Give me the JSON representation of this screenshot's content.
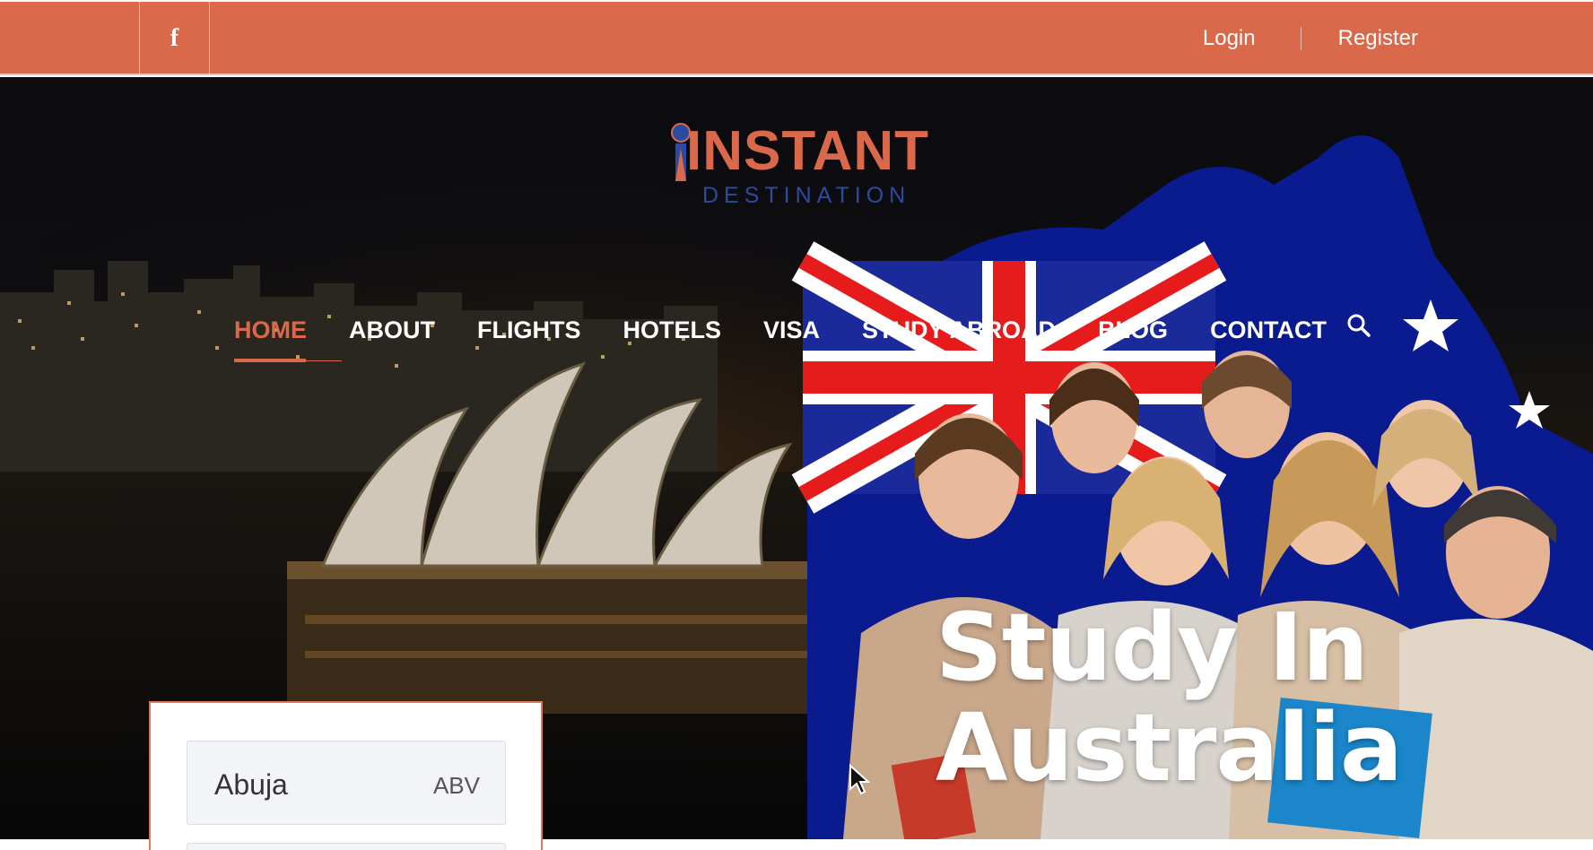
{
  "topbar": {
    "social_icon": "facebook-icon",
    "social_glyph": "f",
    "login_label": "Login",
    "register_label": "Register"
  },
  "brand": {
    "name_main": "INSTANT",
    "name_sub": "DESTINATION",
    "primary_color": "#d9694a",
    "secondary_color": "#2c4ba0"
  },
  "nav": {
    "items": [
      {
        "label": "HOME",
        "active": true
      },
      {
        "label": "ABOUT"
      },
      {
        "label": "FLIGHTS"
      },
      {
        "label": "HOTELS"
      },
      {
        "label": "VISA"
      },
      {
        "label": "STUDY ABROAD"
      },
      {
        "label": "BLOG"
      },
      {
        "label": "CONTACT"
      }
    ],
    "search_icon": "search-icon"
  },
  "hero": {
    "headline_line1": "Study In",
    "headline_line2": "Australia"
  },
  "search_widget": {
    "from_city": "Abuja",
    "from_code": "ABV"
  }
}
